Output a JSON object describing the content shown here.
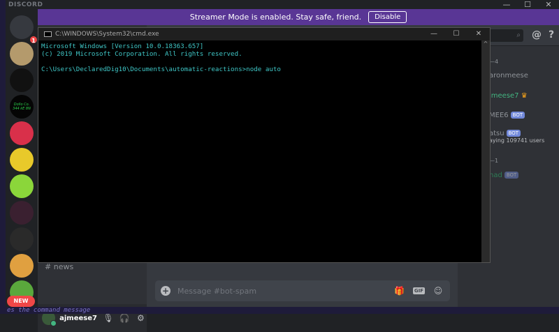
{
  "app": {
    "brand": "DISCORD",
    "window_controls": [
      "—",
      "☐",
      "✕"
    ]
  },
  "guilds": {
    "home_badge": "1",
    "server_logo_text": "Dollo Co. 344 kE 8N",
    "new_label": "NEW"
  },
  "banner": {
    "text": "Streamer Mode is enabled. Stay safe, friend.",
    "disable_label": "Disable"
  },
  "channels": {
    "items": [
      {
        "label": "news"
      }
    ]
  },
  "user": {
    "name": "ajmeese7"
  },
  "composer": {
    "placeholder": "Message #bot-spam",
    "gif_label": "GIF"
  },
  "members": {
    "groups": [
      "—4",
      "—1"
    ],
    "items": [
      {
        "name": "aronmeese",
        "color": "#8e9297"
      },
      {
        "name": "jmeese7",
        "color": "#43b581",
        "crown": true
      },
      {
        "name": "MEE6",
        "bot": "BOT"
      },
      {
        "name": "atsu",
        "bot": "BOT",
        "status": "aying 109741 users"
      },
      {
        "name": "had",
        "bot": "BOT",
        "color": "#2d7d55"
      }
    ]
  },
  "cmd": {
    "title": "C:\\WINDOWS\\System32\\cmd.exe",
    "lines": [
      "Microsoft Windows [Version 10.0.18363.657]",
      "(c) 2019 Microsoft Corporation. All rights reserved.",
      "",
      "C:\\Users\\DeclaredDig10\\Documents\\automatic-reactions>node auto"
    ]
  },
  "bottom_strip": "es the command message"
}
